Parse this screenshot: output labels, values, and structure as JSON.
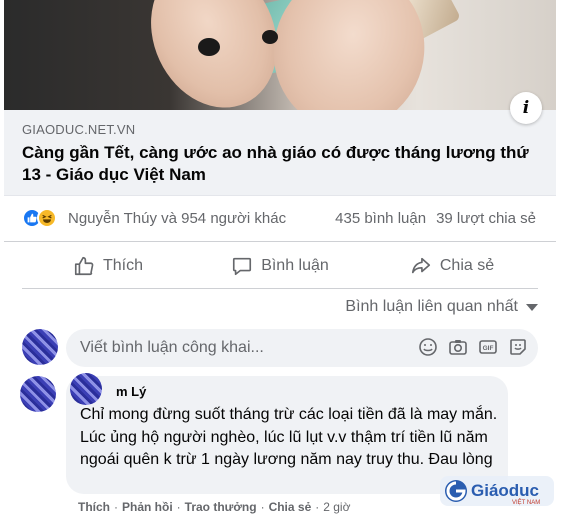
{
  "link": {
    "domain": "GIAODUC.NET.VN",
    "title": "Càng gần Tết, càng ước ao nhà giáo có được tháng lương thứ 13 - Giáo dục Việt Nam",
    "info_label": "i"
  },
  "reactions": {
    "names": "Nguyễn Thúy và 954 người khác",
    "comments": "435 bình luận",
    "shares": "39 lượt chia sẻ",
    "icons": [
      "like-icon",
      "haha-icon"
    ]
  },
  "actions": {
    "like": "Thích",
    "comment": "Bình luận",
    "share": "Chia sẻ"
  },
  "sort": {
    "label": "Bình luận liên quan nhất"
  },
  "composer": {
    "placeholder": "Viết bình luận công khai..."
  },
  "comment": {
    "author": "m Lý",
    "text": "Chỉ mong đừng suốt tháng trừ các loại tiền đã là may mắn. Lúc ủng hộ người nghèo, lúc lũ lụt v.v thậm trí tiền lũ năm ngoái quên k trừ 1 ngày lương năm nay truy thu. Đau lòng",
    "actions": {
      "like": "Thích",
      "reply": "Phản hồi",
      "reward": "Trao thưởng",
      "share": "Chia sẻ",
      "time": "2 giờ"
    }
  },
  "watermark": {
    "text": "Giáoduc",
    "sub": "VIỆT NAM"
  },
  "colors": {
    "facebook_blue": "#1877f2",
    "haha_yellow": "#f7b928",
    "secondary_text": "#65676b",
    "bubble_bg": "#f0f2f5"
  }
}
